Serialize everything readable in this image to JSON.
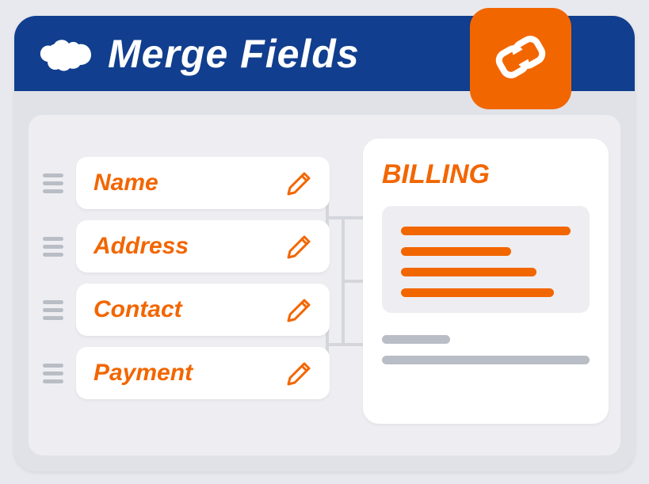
{
  "header": {
    "title": "Merge Fields"
  },
  "fields": [
    {
      "label": "Name"
    },
    {
      "label": "Address"
    },
    {
      "label": "Contact"
    },
    {
      "label": "Payment"
    }
  ],
  "preview": {
    "title": "BILLING"
  },
  "colors": {
    "brand": "#113e8e",
    "accent": "#f26600"
  }
}
